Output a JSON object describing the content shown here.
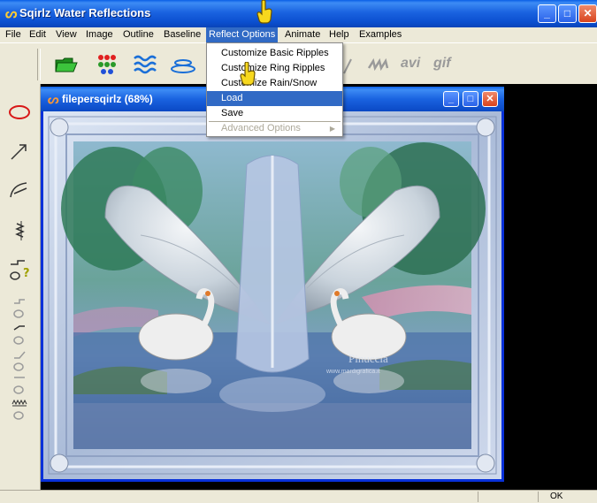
{
  "window": {
    "title": "Sqirlz Water Reflections",
    "controls": {
      "minimize": "_",
      "maximize": "□",
      "close": "✕"
    }
  },
  "menu": {
    "items": [
      "File",
      "Edit",
      "View",
      "Image",
      "Outline",
      "Baseline",
      "Reflect Options",
      "Animate",
      "Help",
      "Examples"
    ],
    "active": "Reflect Options"
  },
  "dropdown": {
    "items": [
      {
        "label": "Customize Basic Ripples",
        "state": "normal"
      },
      {
        "label": "Customize Ring Ripples",
        "state": "normal"
      },
      {
        "label": "Customize Rain/Snow",
        "state": "normal"
      },
      {
        "label": "Load",
        "state": "selected"
      },
      {
        "label": "Save",
        "state": "normal"
      },
      {
        "label": "Advanced Options",
        "state": "disabled",
        "submenu": true
      }
    ]
  },
  "toolbar": {
    "text_buttons": [
      "avi",
      "gif"
    ]
  },
  "document": {
    "title": "filepersqirlz  (68%)",
    "watermark": "Pinuccia",
    "watermark_url": "www.mardigrafica.it"
  },
  "status": {
    "text": "OK"
  },
  "colors": {
    "accent": "#316ac5",
    "titlebar": "#0a5fe6",
    "chrome": "#ece9d8"
  }
}
